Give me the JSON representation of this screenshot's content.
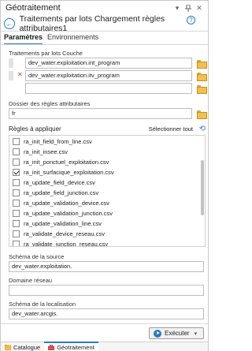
{
  "pane": {
    "title": "Géotraitement",
    "tool_title": "Traitements par lots Chargement règles attributaires1"
  },
  "tabs": [
    {
      "label": "Paramètres",
      "active": true
    },
    {
      "label": "Environnements",
      "active": false
    }
  ],
  "params": {
    "batch_label": "Traitements par lots Couche",
    "batch_values": [
      "dev_water.exploitation.int_program",
      "dev_water.exploitation.itv_program",
      ""
    ],
    "rules_folder_label": "Dossier des règles attributaires",
    "rules_folder_value": "fr",
    "rules_label": "Règles à appliquer",
    "select_all": "Sélectionner tout",
    "rules": [
      {
        "name": "ra_init_field_from_line.csv",
        "checked": false
      },
      {
        "name": "ra_init_insee.csv",
        "checked": false
      },
      {
        "name": "ra_init_ponctuel_exploitation.csv",
        "checked": false
      },
      {
        "name": "ra_init_surfacique_exploitation.csv",
        "checked": true
      },
      {
        "name": "ra_update_field_device.csv",
        "checked": false
      },
      {
        "name": "ra_update_field_junction.csv",
        "checked": false
      },
      {
        "name": "ra_update_validation_device.csv",
        "checked": false
      },
      {
        "name": "ra_update_validation_junction.csv",
        "checked": false
      },
      {
        "name": "ra_update_validation_line.csv",
        "checked": false
      },
      {
        "name": "ra_validate_device_reseau.csv",
        "checked": false
      },
      {
        "name": "ra_validate_junction_reseau.csv",
        "checked": false
      }
    ],
    "source_schema_label": "Schéma de la source",
    "source_schema_value": "dev_water.exploitation.",
    "domain_label": "Domaine réseau",
    "domain_value": "",
    "loc_schema_label": "Schéma de la localisation",
    "loc_schema_value": "dev_water.arcgis."
  },
  "footer": {
    "run_label": "Exécuter"
  },
  "bottom_tabs": [
    {
      "label": "Catalogue",
      "active": false
    },
    {
      "label": "Géotraitement",
      "active": true
    }
  ],
  "colors": {
    "accent": "#2a7ac0",
    "folder": "#f2c04b"
  }
}
